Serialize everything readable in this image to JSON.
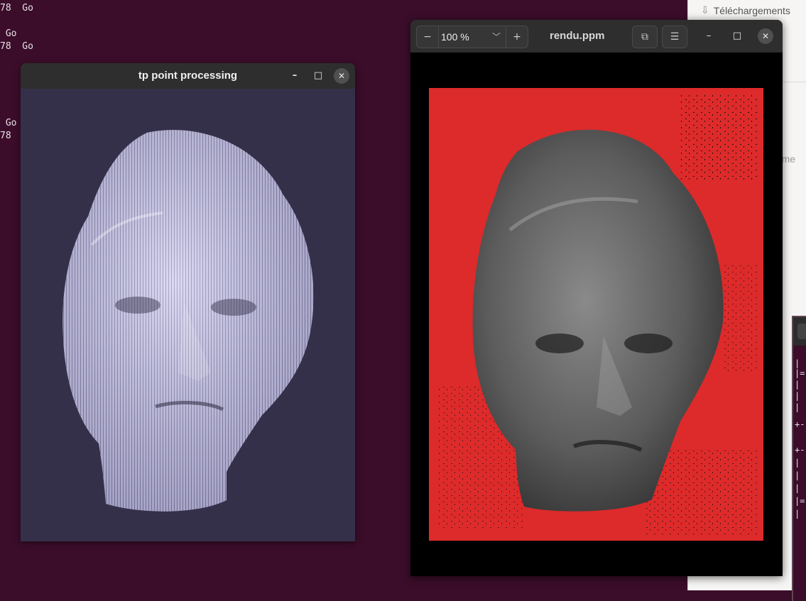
{
  "terminal": {
    "lines": [
      "78  Go",
      " Go",
      "78  Go",
      " Go",
      "78  G"
    ]
  },
  "file_manager": {
    "downloads_label": "Téléchargements",
    "partial_text": "teme"
  },
  "terminal2": {
    "lines": [
      "|",
      "|=",
      "|",
      "|",
      "|",
      "+-",
      "+-",
      "|",
      "|",
      "|",
      "|=",
      "|"
    ]
  },
  "window_points": {
    "title": "tp point processing",
    "minimize": "–",
    "maximize": "□",
    "close": "✕",
    "colors": {
      "background": "#343049",
      "head": "#c9c6f0"
    }
  },
  "window_viewer": {
    "title": "rendu.ppm",
    "zoom_level": "100 %",
    "zoom_out": "−",
    "zoom_in": "+",
    "zoom_dropdown": "﹀",
    "copy_icon": "⧉",
    "menu_icon": "☰",
    "minimize": "–",
    "maximize": "□",
    "close": "✕",
    "colors": {
      "background": "#dd2a2a",
      "head": "#5c5c5c"
    }
  }
}
